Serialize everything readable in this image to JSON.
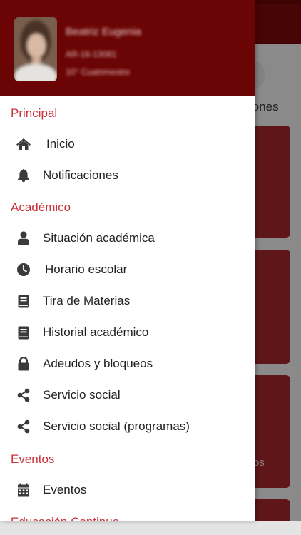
{
  "background": {
    "tab_text_fragment": "iones",
    "card_text_fragment": "os"
  },
  "user": {
    "name": "Beatriz Eugenia",
    "id": "AR-16-13081",
    "term": "10° Cuatrimestre"
  },
  "sections": {
    "principal": "Principal",
    "academico": "Académico",
    "eventos": "Eventos",
    "educacion": "Educación Continua"
  },
  "menu": {
    "inicio": "Inicio",
    "notificaciones": "Notificaciones",
    "situacion": "Situación académica",
    "horario": "Horario escolar",
    "tira": "Tira de Materias",
    "historial": "Historial académico",
    "adeudos": "Adeudos y bloqueos",
    "servicio_social": "Servicio social",
    "servicio_social_programas": "Servicio social (programas)",
    "eventos": "Eventos"
  },
  "icons": {
    "inicio": "home-icon",
    "notificaciones": "bell-icon",
    "situacion": "user-icon",
    "horario": "clock-icon",
    "tira": "book-icon",
    "historial": "book-icon",
    "adeudos": "lock-icon",
    "servicio_social": "share-icon",
    "servicio_social_programas": "share-icon",
    "eventos": "calendar-icon"
  },
  "colors": {
    "header": "#6b0404",
    "section_title": "#c9323b",
    "card": "#a2272b"
  }
}
